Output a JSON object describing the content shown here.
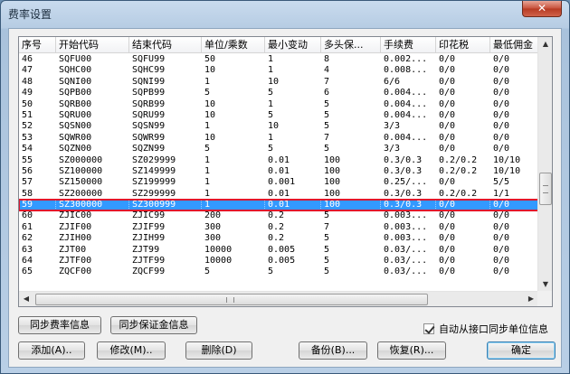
{
  "window": {
    "title": "费率设置",
    "close_label": "✕"
  },
  "table": {
    "columns": [
      {
        "label": "序号",
        "w": 41
      },
      {
        "label": "开始代码",
        "w": 81
      },
      {
        "label": "结束代码",
        "w": 80
      },
      {
        "label": "单位/乘数",
        "w": 70
      },
      {
        "label": "最小变动",
        "w": 62
      },
      {
        "label": "多头保...",
        "w": 66
      },
      {
        "label": "手续费",
        "w": 61
      },
      {
        "label": "印花税",
        "w": 60
      },
      {
        "label": "最低佣金",
        "w": 53
      }
    ],
    "rows": [
      [
        "46",
        "SQFU00",
        "SQFU99",
        "50",
        "1",
        "8",
        "0.002...",
        "0/0",
        "0/0"
      ],
      [
        "47",
        "SQHC00",
        "SQHC99",
        "10",
        "1",
        "4",
        "0.008...",
        "0/0",
        "0/0"
      ],
      [
        "48",
        "SQNI00",
        "SQNI99",
        "1",
        "10",
        "7",
        "6/6",
        "0/0",
        "0/0"
      ],
      [
        "49",
        "SQPB00",
        "SQPB99",
        "5",
        "5",
        "6",
        "0.004...",
        "0/0",
        "0/0"
      ],
      [
        "50",
        "SQRB00",
        "SQRB99",
        "10",
        "1",
        "5",
        "0.004...",
        "0/0",
        "0/0"
      ],
      [
        "51",
        "SQRU00",
        "SQRU99",
        "10",
        "5",
        "5",
        "0.004...",
        "0/0",
        "0/0"
      ],
      [
        "52",
        "SQSN00",
        "SQSN99",
        "1",
        "10",
        "5",
        "3/3",
        "0/0",
        "0/0"
      ],
      [
        "53",
        "SQWR00",
        "SQWR99",
        "10",
        "1",
        "7",
        "0.004...",
        "0/0",
        "0/0"
      ],
      [
        "54",
        "SQZN00",
        "SQZN99",
        "5",
        "5",
        "5",
        "3/3",
        "0/0",
        "0/0"
      ],
      [
        "55",
        "SZ000000",
        "SZ029999",
        "1",
        "0.01",
        "100",
        "0.3/0.3",
        "0.2/0.2",
        "10/10"
      ],
      [
        "56",
        "SZ100000",
        "SZ149999",
        "1",
        "0.01",
        "100",
        "0.3/0.3",
        "0.2/0.2",
        "10/10"
      ],
      [
        "57",
        "SZ150000",
        "SZ199999",
        "1",
        "0.001",
        "100",
        "0.25/...",
        "0/0",
        "5/5"
      ],
      [
        "58",
        "SZ200000",
        "SZ299999",
        "1",
        "0.01",
        "100",
        "0.3/0.3",
        "0.2/0.2",
        "1/1"
      ],
      [
        "59",
        "SZ300000",
        "SZ300999",
        "1",
        "0.01",
        "100",
        "0.3/0.3",
        "0/0",
        "0/0"
      ],
      [
        "60",
        "ZJIC00",
        "ZJIC99",
        "200",
        "0.2",
        "5",
        "0.003...",
        "0/0",
        "0/0"
      ],
      [
        "61",
        "ZJIF00",
        "ZJIF99",
        "300",
        "0.2",
        "7",
        "0.003...",
        "0/0",
        "0/0"
      ],
      [
        "62",
        "ZJIH00",
        "ZJIH99",
        "300",
        "0.2",
        "5",
        "0.003...",
        "0/0",
        "0/0"
      ],
      [
        "63",
        "ZJT00",
        "ZJT99",
        "10000",
        "0.005",
        "5",
        "0.03/...",
        "0/0",
        "0/0"
      ],
      [
        "64",
        "ZJTF00",
        "ZJTF99",
        "10000",
        "0.005",
        "5",
        "0.03/...",
        "0/0",
        "0/0"
      ],
      [
        "65",
        "ZQCF00",
        "ZQCF99",
        "5",
        "5",
        "5",
        "0.03/...",
        "0/0",
        "0/0"
      ]
    ],
    "selected_index": 13
  },
  "buttons": {
    "sync_rate": "同步费率信息",
    "sync_margin": "同步保证金信息",
    "add": "添加(A)..",
    "modify": "修改(M)..",
    "delete": "删除(D)",
    "backup": "备份(B)...",
    "restore": "恢复(R)...",
    "ok": "确定"
  },
  "checkbox": {
    "label": "自动从接口同步单位信息",
    "checked": true
  }
}
